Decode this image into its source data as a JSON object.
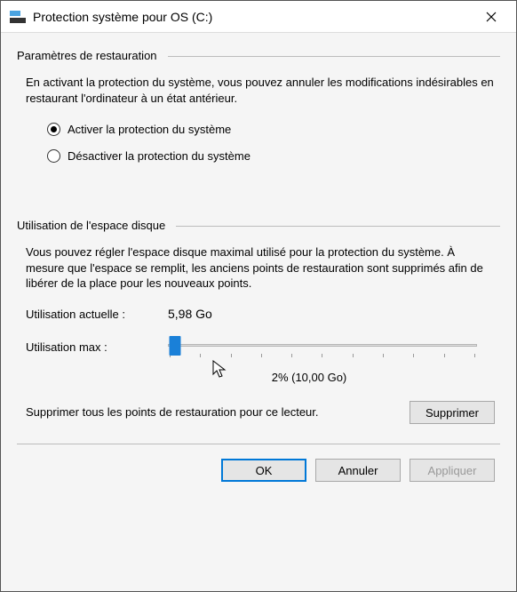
{
  "window": {
    "title": "Protection système pour OS (C:)"
  },
  "restore": {
    "heading": "Paramètres de restauration",
    "desc": "En activant la protection du système, vous pouvez annuler les modifications indésirables en restaurant l'ordinateur à un état antérieur.",
    "option_enable": "Activer la protection du système",
    "option_disable": "Désactiver la protection du système",
    "selected": "enable"
  },
  "disk": {
    "heading": "Utilisation de l'espace disque",
    "desc": "Vous pouvez régler l'espace disque maximal utilisé pour la protection du système. À mesure que l'espace se remplit, les anciens points de restauration sont supprimés afin de libérer de la place pour les nouveaux points.",
    "current_label": "Utilisation actuelle :",
    "current_value": "5,98 Go",
    "max_label": "Utilisation max :",
    "max_value": "2% (10,00 Go)",
    "slider_percent": 2
  },
  "delete": {
    "text": "Supprimer tous les points de restauration pour ce lecteur.",
    "button": "Supprimer"
  },
  "buttons": {
    "ok": "OK",
    "cancel": "Annuler",
    "apply": "Appliquer"
  }
}
